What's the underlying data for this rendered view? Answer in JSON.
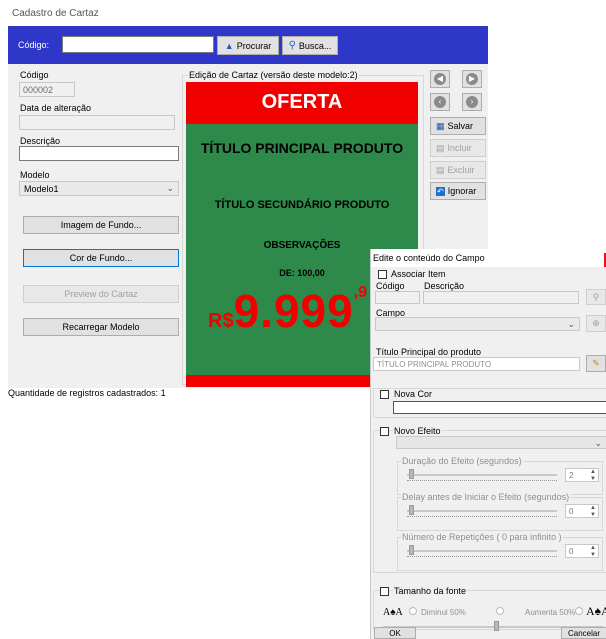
{
  "window": {
    "title": "Cadastro de Cartaz"
  },
  "toolbar": {
    "codigo_label": "Código:",
    "procurar_label": "Procurar",
    "busca_label": "Busca...",
    "bg_color": "#2e37c8"
  },
  "form": {
    "codigo_label": "Código",
    "codigo_value": "000002",
    "data_label": "Data de alteração",
    "data_value": "",
    "descricao_label": "Descrição",
    "descricao_value": "",
    "modelo_label": "Modelo",
    "modelo_value": "Modelo1",
    "imagem_fundo_label": "Imagem de Fundo...",
    "cor_fundo_label": "Cor de Fundo...",
    "preview_label": "Preview do Cartaz",
    "recarregar_label": "Recarregar Modelo"
  },
  "edit_group": {
    "title": "Edição de Cartaz (versão deste modelo:2)"
  },
  "poster": {
    "bg_color": "#2d8a4b",
    "accent_color": "#f20000",
    "oferta": "OFERTA",
    "titulo_principal": "TÍTULO PRINCIPAL PRODUTO",
    "titulo_secundario": "TÍTULO SECUNDÁRIO PRODUTO",
    "observacoes": "OBSERVAÇÕES",
    "de_preco": "DE: 100,00",
    "moeda": "R$",
    "preco": "9.999",
    "preco_cents": ",9"
  },
  "side_buttons": {
    "salvar_label": "Salvar",
    "incluir_label": "Incluir",
    "excluir_label": "Excluir",
    "ignorar_label": "Ignorar"
  },
  "status": {
    "text": "Quantidade de registros cadastrados:  1"
  },
  "dialog": {
    "title": "Edite o conteúdo do Campo",
    "associar_label": "Associar Item",
    "codigo_label": "Código",
    "descricao_label": "Descrição",
    "campo_label": "Campo",
    "titulo_label": "Título Principal do produto",
    "titulo_value": "TÍTULO PRINCIPAL PRODUTO",
    "nova_cor_label": "Nova Cor",
    "novo_efeito_label": "Novo Efeito",
    "duracao_label": "Duração do Efeito (segundos)",
    "duracao_value": "2",
    "delay_label": "Delay antes de Iniciar o Efeito (segundos)",
    "delay_value": "0",
    "repeticoes_label": "Número de Repetições ( 0 para infinito )",
    "repeticoes_value": "0",
    "tamanho_label": "Tamanho da fonte",
    "diminui_label": "Diminui 50%",
    "aumenta_label": "Aumenta 50%",
    "font_small_glyph": "A♠A",
    "font_big_glyph": "A♠A",
    "ok_label": "OK",
    "cancelar_label": "Cancelar"
  }
}
